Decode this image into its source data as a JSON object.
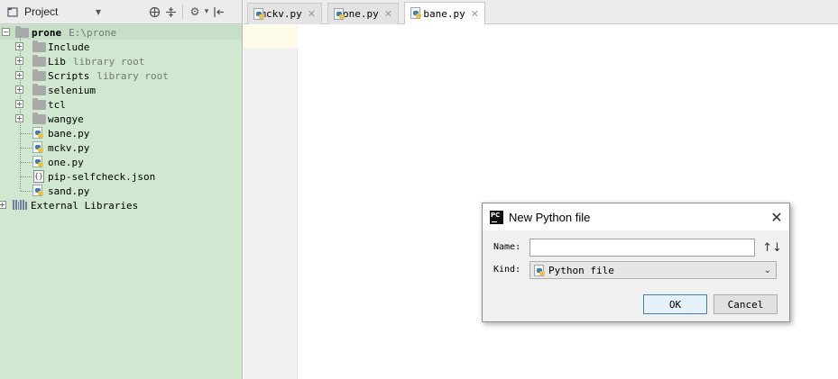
{
  "project_panel": {
    "title": "Project",
    "toolbar_icons": [
      "project-view-icon",
      "dropdown-icon",
      "target-icon",
      "collapse-icon",
      "gear-icon",
      "hide-icon"
    ]
  },
  "tree": {
    "root": {
      "name": "prone",
      "path": "E:\\prone"
    },
    "items": [
      {
        "name": "Include",
        "hint": "",
        "kind": "folder"
      },
      {
        "name": "Lib",
        "hint": "library root",
        "kind": "folder"
      },
      {
        "name": "Scripts",
        "hint": "library root",
        "kind": "folder"
      },
      {
        "name": "selenium",
        "hint": "",
        "kind": "folder"
      },
      {
        "name": "tcl",
        "hint": "",
        "kind": "folder"
      },
      {
        "name": "wangye",
        "hint": "",
        "kind": "folder"
      },
      {
        "name": "bane.py",
        "hint": "",
        "kind": "python"
      },
      {
        "name": "mckv.py",
        "hint": "",
        "kind": "python"
      },
      {
        "name": "one.py",
        "hint": "",
        "kind": "python"
      },
      {
        "name": "pip-selfcheck.json",
        "hint": "",
        "kind": "json"
      },
      {
        "name": "sand.py",
        "hint": "",
        "kind": "python"
      }
    ],
    "external": "External Libraries"
  },
  "tabs": [
    {
      "label": "mckv.py"
    },
    {
      "label": "one.py"
    },
    {
      "label": "bane.py"
    }
  ],
  "active_tab": "bane.py",
  "dialog": {
    "title": "New Python file",
    "name_label": "Name:",
    "name_value": "",
    "kind_label": "Kind:",
    "kind_value": "Python file",
    "ok": "OK",
    "cancel": "Cancel"
  },
  "colors": {
    "panel_bg": "#cfe8cf",
    "ok_border": "#3c7fb1"
  }
}
